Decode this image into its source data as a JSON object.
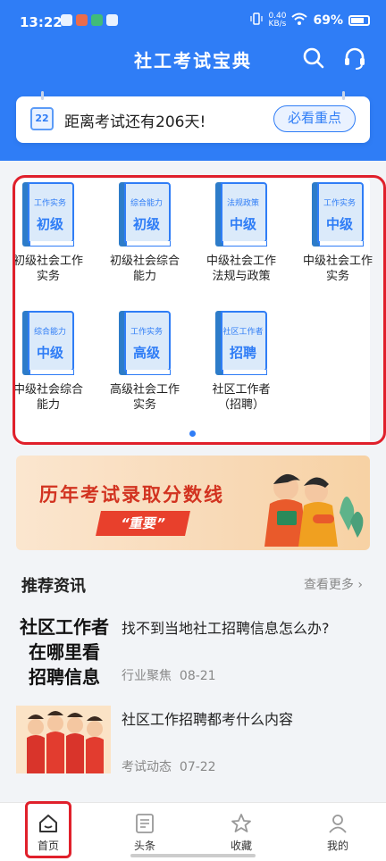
{
  "status": {
    "time": "13:22",
    "net_speed_value": "0.40",
    "net_speed_unit": "KB/s",
    "battery": "69%"
  },
  "header": {
    "title": "社工考试宝典",
    "search_icon": "search-icon",
    "service_icon": "headset-icon"
  },
  "notice": {
    "calendar_day": "22",
    "text": "距离考试还有206天!",
    "button": "必看重点"
  },
  "categories": [
    {
      "top": "工作实务",
      "level": "初级",
      "label_line1": "初级社会工作",
      "label_line2": "实务"
    },
    {
      "top": "综合能力",
      "level": "初级",
      "label_line1": "初级社会综合",
      "label_line2": "能力"
    },
    {
      "top": "法规政策",
      "level": "中级",
      "label_line1": "中级社会工作",
      "label_line2": "法规与政策"
    },
    {
      "top": "工作实务",
      "level": "中级",
      "label_line1": "中级社会工作",
      "label_line2": "实务"
    },
    {
      "top": "综合能力",
      "level": "中级",
      "label_line1": "中级社会综合",
      "label_line2": "能力"
    },
    {
      "top": "工作实务",
      "level": "高级",
      "label_line1": "高级社会工作",
      "label_line2": "实务"
    },
    {
      "top": "社区工作者",
      "level": "招聘",
      "label_line1": "社区工作者",
      "label_line2": "（招聘）"
    }
  ],
  "banner": {
    "title": "历年考试录取分数线",
    "tag": "“重要”"
  },
  "section": {
    "title": "推荐资讯",
    "more": "查看更多 ›"
  },
  "news": [
    {
      "thumb_line1": "社区工作者",
      "thumb_line2": "在哪里看",
      "thumb_line3": "招聘信息",
      "title": "找不到当地社工招聘信息怎么办?",
      "category": "行业聚焦",
      "date": "08-21"
    },
    {
      "title": "社区工作招聘都考什么内容",
      "category": "考试动态",
      "date": "07-22"
    }
  ],
  "bottom_nav": [
    {
      "label": "首页",
      "icon": "home-icon",
      "active": true
    },
    {
      "label": "头条",
      "icon": "news-icon"
    },
    {
      "label": "收藏",
      "icon": "star-icon"
    },
    {
      "label": "我的",
      "icon": "profile-icon"
    }
  ]
}
